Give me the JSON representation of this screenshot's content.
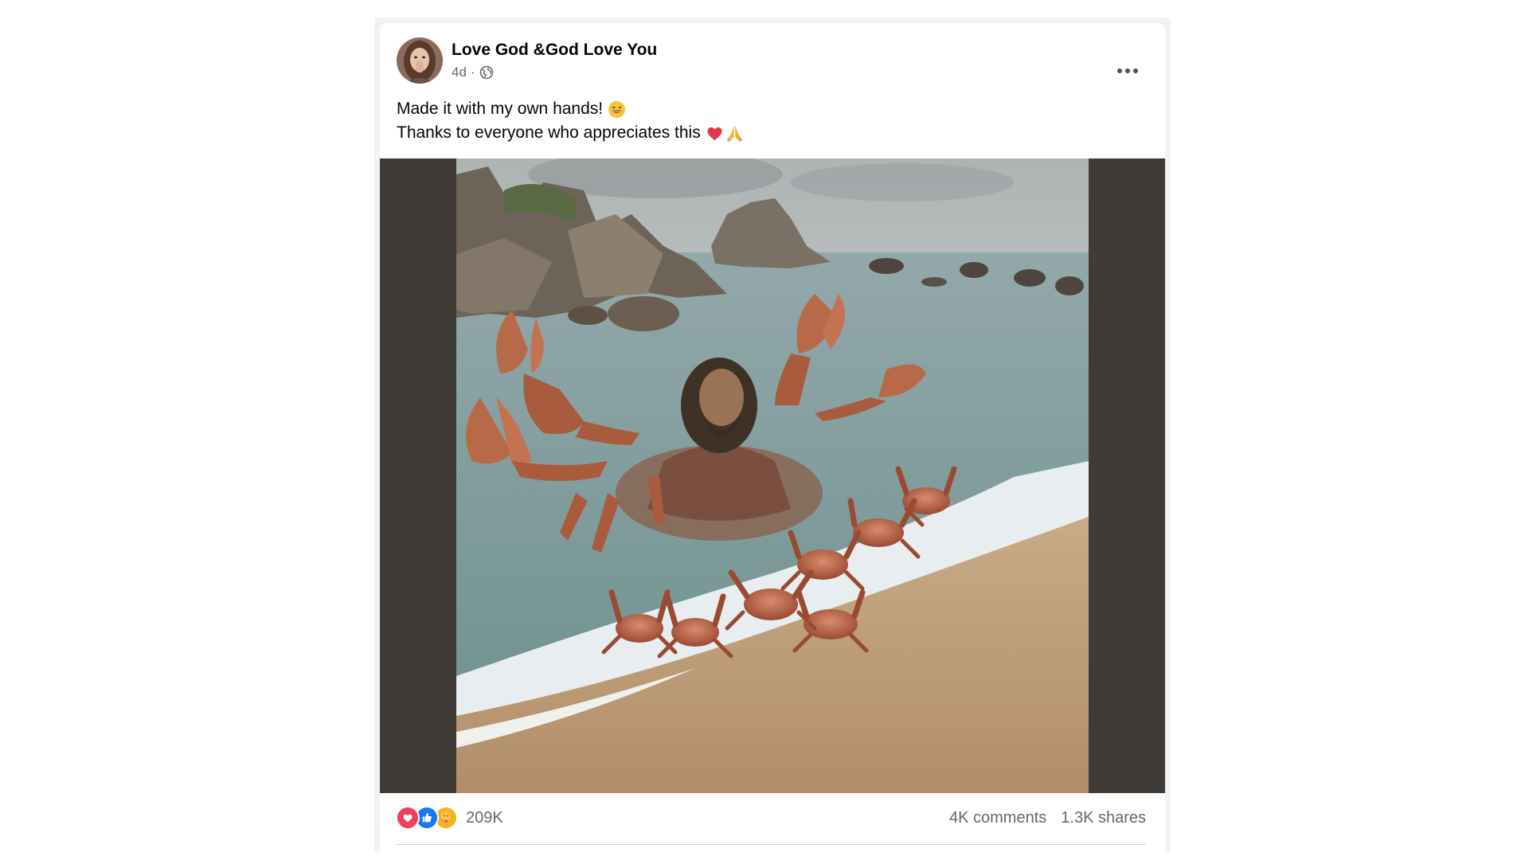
{
  "post": {
    "author": "Love God &God Love You",
    "time": "4d",
    "separator": "·",
    "privacy_icon": "globe-icon",
    "caption_line1": "Made it with my own hands!",
    "caption_line2": "Thanks to everyone who appreciates this",
    "caption_emojis": [
      "grinning-face-emoji",
      "red-heart-emoji",
      "folded-hands-emoji"
    ],
    "image_description_icon": "ai-image"
  },
  "footer": {
    "reactions": [
      "love-reaction-icon",
      "like-reaction-icon",
      "care-reaction-icon"
    ],
    "reaction_count": "209K",
    "comments": "4K comments",
    "shares": "1.3K shares"
  },
  "colors": {
    "text_primary": "#050505",
    "text_secondary": "#65676b",
    "like_blue": "#1877f2",
    "love_red": "#f33e58",
    "care_yellow": "#f7b125",
    "media_matte": "#403b37"
  }
}
